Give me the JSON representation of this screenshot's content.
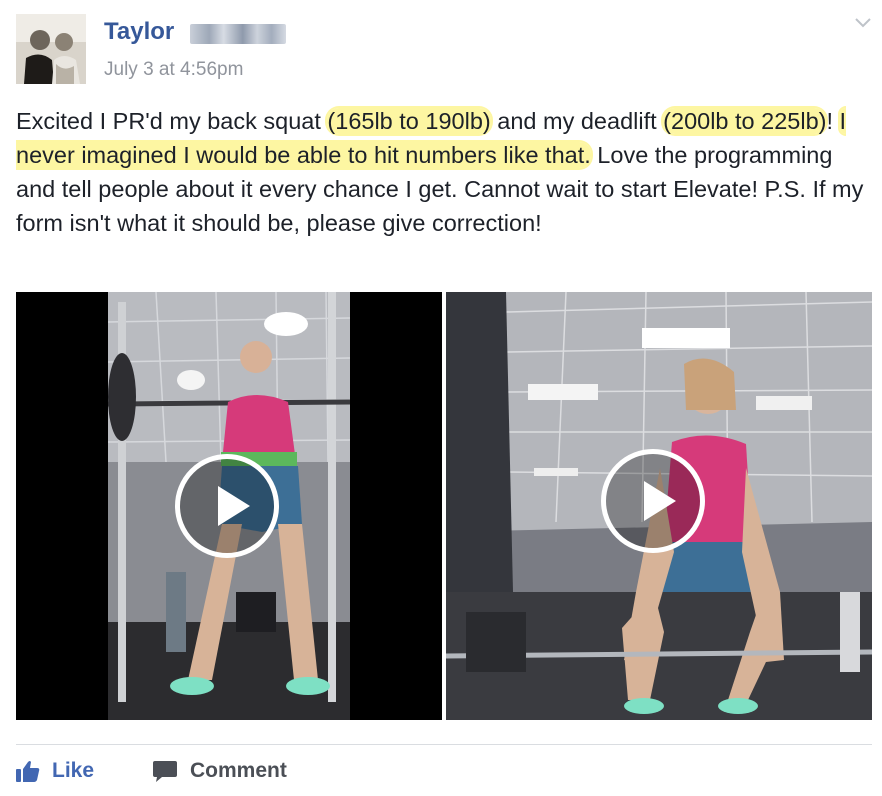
{
  "author": {
    "name": "Taylor",
    "timestamp": "July 3 at 4:56pm"
  },
  "post": {
    "text_segments": [
      {
        "text": "Excited I PR'd my back squat ",
        "highlight": false
      },
      {
        "text": "(165lb to 190lb)",
        "highlight": true
      },
      {
        "text": " and my deadlift ",
        "highlight": false
      },
      {
        "text": "(200lb to 225lb)",
        "highlight": true
      },
      {
        "text": "! ",
        "highlight": false
      },
      {
        "text": "I never imagined I would be able to hit numbers like that.",
        "highlight": true
      },
      {
        "text": " Love the programming and tell people about it every chance I get. Cannot wait to start Elevate! P.S. If my form isn't what it should be, please give correction!",
        "highlight": false
      }
    ]
  },
  "videos": [
    {
      "label": "back-squat-video",
      "has_play_button": true
    },
    {
      "label": "deadlift-video",
      "has_play_button": true
    }
  ],
  "actions": {
    "like_label": "Like",
    "comment_label": "Comment"
  },
  "colors": {
    "link_blue": "#365899",
    "like_blue": "#4267b2",
    "highlight": "#fdf6a2",
    "meta_gray": "#90949c"
  },
  "icons": [
    "chevron-down-icon",
    "play-icon",
    "thumbs-up-icon",
    "comment-icon"
  ]
}
